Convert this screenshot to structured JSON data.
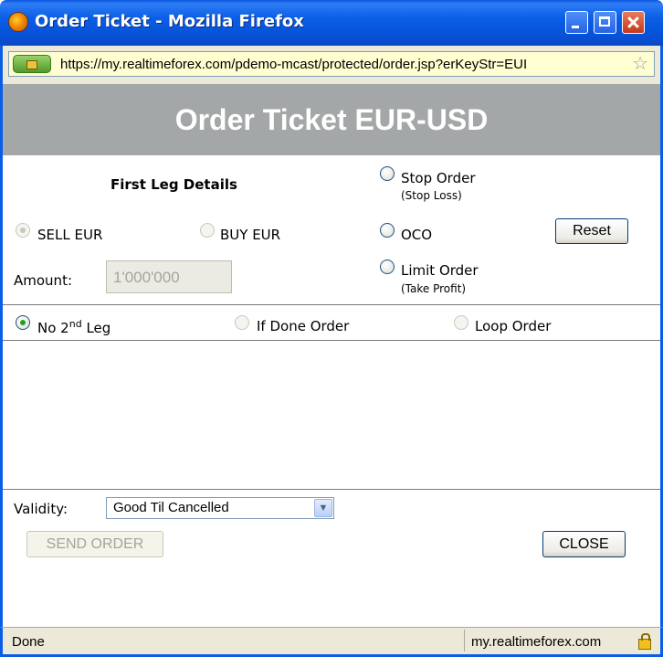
{
  "window": {
    "title": "Order Ticket - Mozilla Firefox",
    "url": "https://my.realtimeforex.com/pdemo-mcast/protected/order.jsp?erKeyStr=EUI",
    "icons": [
      "firefox-icon",
      "minimize-icon",
      "maximize-icon",
      "close-icon",
      "site-identity-icon",
      "bookmark-star-icon"
    ]
  },
  "header": {
    "title": "Order Ticket EUR-USD",
    "bg_color": "#a3a7a8"
  },
  "first_leg": {
    "heading": "First Leg Details",
    "sell_label": "SELL EUR",
    "buy_label": "BUY EUR",
    "sell_selected": true,
    "amount_label": "Amount:",
    "amount_value": "1'000'000"
  },
  "order_types": {
    "stop_label": "Stop Order",
    "stop_sub": "(Stop Loss)",
    "oco_label": "OCO",
    "limit_label": "Limit Order",
    "limit_sub": "(Take Profit)",
    "reset_label": "Reset"
  },
  "second_leg": {
    "no_leg_label": "No 2",
    "no_leg_sup": "nd",
    "no_leg_suffix": " Leg",
    "if_done_label": "If Done Order",
    "loop_label": "Loop Order",
    "selected": "no_second_leg"
  },
  "footer": {
    "validity_label": "Validity:",
    "validity_value": "Good Til Cancelled",
    "send_label": "SEND ORDER",
    "close_label": "CLOSE"
  },
  "status": {
    "text": "Done",
    "host": "my.realtimeforex.com"
  },
  "colors": {
    "titlebar": "#0a5ee6",
    "selected_radio": "#21a121"
  }
}
